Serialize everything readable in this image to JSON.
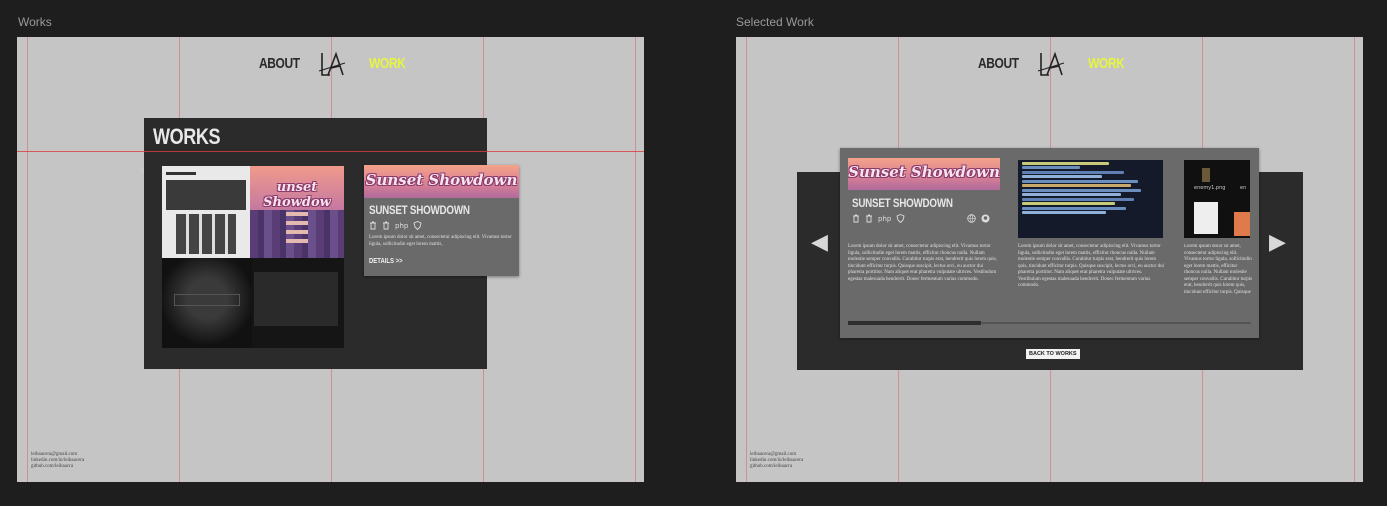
{
  "frames": {
    "works_label": "Works",
    "selected_label": "Selected Work"
  },
  "nav": {
    "about": "ABOUT",
    "work": "WORK",
    "logo": "LA"
  },
  "works_page": {
    "title": "WORKS",
    "card": {
      "banner": "Sunset Showdown",
      "title": "SUNSET SHOWDOWN",
      "tech": [
        "trash-icon",
        "trash-icon",
        "php",
        "shield-icon"
      ],
      "tech_php": "php",
      "description": "Lorem ipsum dolor sit amet, consectetur adipiscing elit. Vivamus tortor ligula, sollicitudin eget lorem mattis,",
      "details": "DETAILS >>"
    },
    "thumb_banner": "unset Showdow"
  },
  "selected_page": {
    "card": {
      "banner": "Sunset Showdown",
      "title": "SUNSET SHOWDOWN",
      "tech_php": "php",
      "description": "Lorem ipsum dolor sit amet, consectetur adipiscing elit. Vivamus tortor ligula, sollicitudin eget lorem mattis, efficitur rhoncus nulla. Nullam molestie semper convallis. Curabitur turpis erat, hendrerit quis lorem quis, tincidunt efficitur turpis. Quisque suscipit, lectus orci, eu auctor dui pharetra porttitor. Nam aliquet erat pharetra vulputate ultrices. Vestibulum egestas malesuada hendrerit. Donec fermentum varius commodo.",
      "description_short": "Lorem ipsum dolor sit amet, consectetur adipiscing elit. Vivamus tortor ligula, sollicitudin eget lorem mattis, efficitur rhoncus nulla. Nullam molestie semper convallis. Curabitur turpis erat, hendrerit quis lorem quis, tincidunt efficitur turpis. Quisque suscipit, lectus orci, eu auctor dui pharetra porttitor. Nam aliquet erat pharetra vulputate ultrices. Vestibulum egestas malesuada hendrerit. Donec fermentum varius commodo.",
      "asset_label": "enemy1.png",
      "asset_label_cut": "en"
    },
    "back": "BACK TO WORKS",
    "progress": 0.33
  },
  "footer": {
    "lines": [
      "leibaacera@gmail.com",
      "linkedin.com/in/leibaacera",
      "github.com/leibaacra"
    ]
  },
  "colors": {
    "accent": "#e6f542",
    "frame_bg": "#c5c5c5",
    "panel": "#2b2b2b",
    "card": "#6a6a6a"
  }
}
